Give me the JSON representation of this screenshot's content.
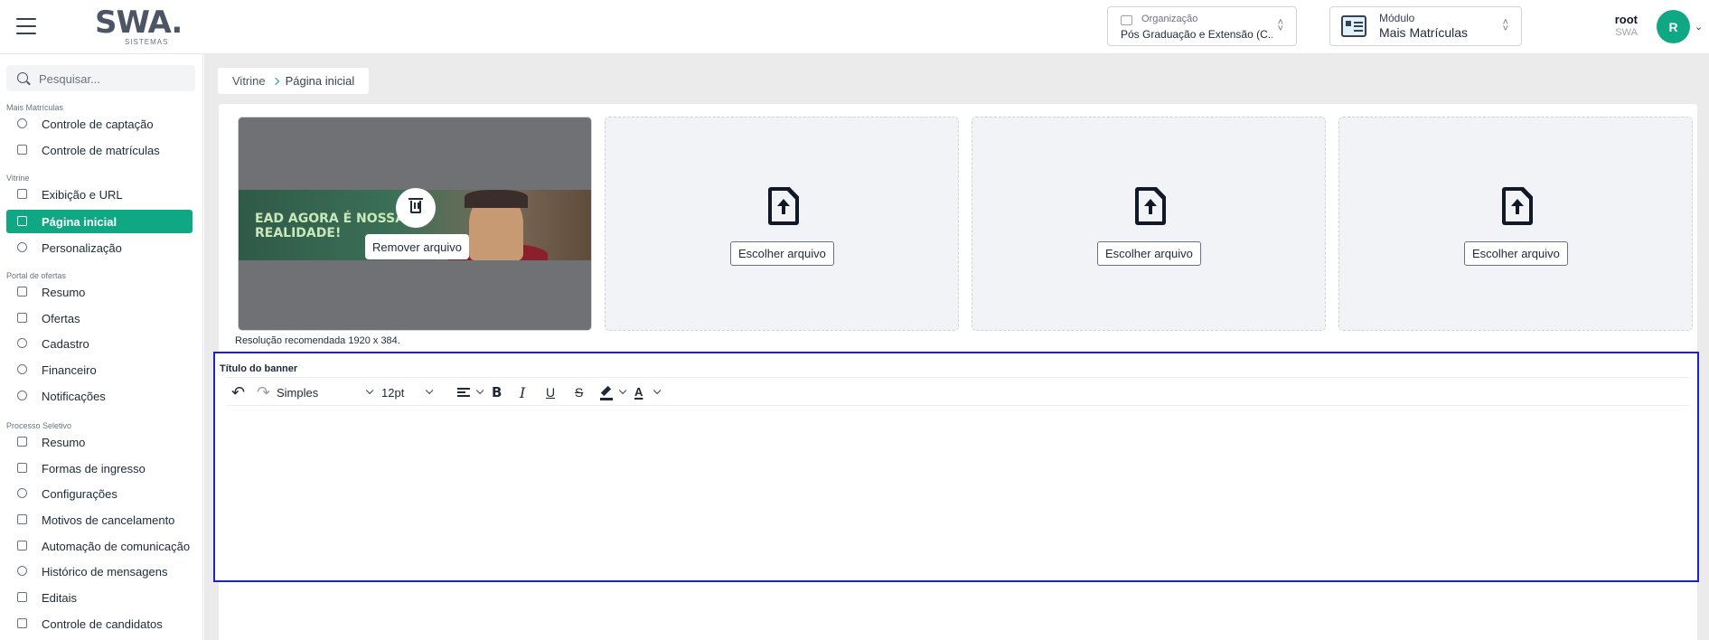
{
  "header": {
    "logo_text": "SWA",
    "logo_sub": "SISTEMAS",
    "org_label": "Organização",
    "org_value": "Pós Graduação e Extensão (C...",
    "module_label": "Módulo",
    "module_value": "Mais Matrículas",
    "user_name": "root",
    "user_org": "SWA",
    "avatar_initial": "R"
  },
  "sidebar": {
    "search_placeholder": "Pesquisar...",
    "sections": [
      {
        "title": "Mais Matrículas",
        "items": [
          "Controle de captação",
          "Controle de matrículas"
        ]
      },
      {
        "title": "Vitrine",
        "items": [
          "Exibição e URL",
          "Página inicial",
          "Personalização"
        ]
      },
      {
        "title": "Portal de ofertas",
        "items": [
          "Resumo",
          "Ofertas",
          "Cadastro",
          "Financeiro",
          "Notificações"
        ]
      },
      {
        "title": "Processo Seletivo",
        "items": [
          "Resumo",
          "Formas de ingresso",
          "Configurações",
          "Motivos de cancelamento",
          "Automação de comunicação",
          "Histórico de mensagens",
          "Editais",
          "Controle de candidatos"
        ]
      }
    ],
    "active_item": "Página inicial"
  },
  "breadcrumb": {
    "items": [
      "Vitrine",
      "Página inicial"
    ]
  },
  "upload": {
    "banner_text_line1": "EAD AGORA É NOSSA",
    "banner_text_line2": "REALIDADE!",
    "remove_label": "Remover arquivo",
    "choose_label": "Escolher arquivo",
    "resolution_note": "Resolução recomendada 1920 x 384."
  },
  "editor": {
    "label": "Título do banner",
    "format_value": "Simples",
    "size_value": "12pt",
    "bold": "B",
    "italic": "I",
    "underline": "U",
    "strike": "S",
    "font_color": "A"
  },
  "colors": {
    "accent": "#10a884",
    "focus_border": "#1d22c8"
  }
}
